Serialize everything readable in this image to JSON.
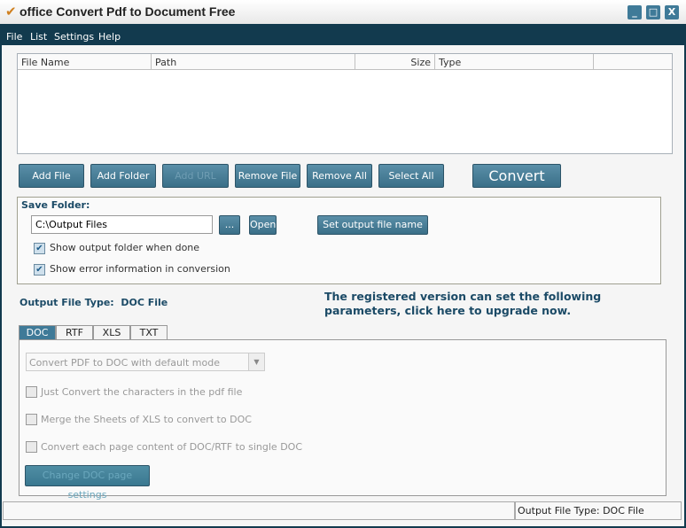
{
  "window": {
    "title": "office Convert Pdf to Document Free"
  },
  "menu": [
    "File",
    "List",
    "Settings",
    "Help"
  ],
  "file_list": {
    "columns": [
      "File Name",
      "Path",
      "Size",
      "Type",
      ""
    ]
  },
  "toolbar": {
    "add_file": "Add File",
    "add_folder": "Add Folder",
    "add_url": "Add URL",
    "remove_file": "Remove File",
    "remove_all": "Remove All",
    "select_all": "Select All",
    "convert": "Convert"
  },
  "save": {
    "label": "Save Folder:",
    "path": "C:\\Output Files",
    "browse": "...",
    "open": "Open",
    "set_name": "Set output file name",
    "show_folder": "Show output folder when done",
    "show_error": "Show error information in conversion"
  },
  "output_type": {
    "label": "Output File Type:",
    "value": "DOC File"
  },
  "upgrade": "The registered version can set the following parameters, click here to upgrade now.",
  "tabs": [
    "DOC",
    "RTF",
    "XLS",
    "TXT"
  ],
  "options": {
    "mode": "Convert PDF to DOC with default mode",
    "opt1": "Just Convert the characters in the pdf file",
    "opt2": "Merge the Sheets of XLS to convert to DOC",
    "opt3": "Convert each page content of DOC/RTF to single DOC",
    "page_settings": "Change DOC page settings"
  },
  "status": {
    "text": "",
    "output": "Output File Type:  DOC File"
  }
}
